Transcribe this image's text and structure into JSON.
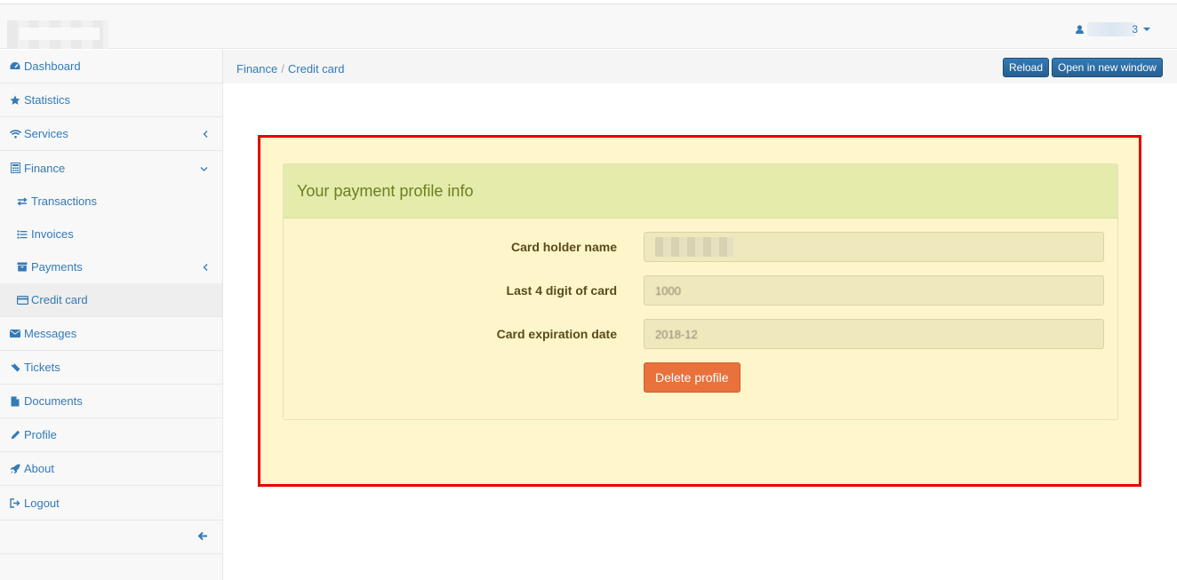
{
  "header": {
    "user_label_tail": "3"
  },
  "sidebar": {
    "items": [
      {
        "label": "Dashboard",
        "icon": "dashboard-icon"
      },
      {
        "label": "Statistics",
        "icon": "star-icon"
      },
      {
        "label": "Services",
        "icon": "wifi-icon"
      },
      {
        "label": "Finance",
        "icon": "calculator-icon"
      },
      {
        "label": "Transactions",
        "icon": "exchange-icon"
      },
      {
        "label": "Invoices",
        "icon": "list-icon"
      },
      {
        "label": "Payments",
        "icon": "archive-icon"
      },
      {
        "label": "Credit card",
        "icon": "credit-card-icon"
      },
      {
        "label": "Messages",
        "icon": "envelope-icon"
      },
      {
        "label": "Tickets",
        "icon": "ticket-icon"
      },
      {
        "label": "Documents",
        "icon": "file-icon"
      },
      {
        "label": "Profile",
        "icon": "pencil-icon"
      },
      {
        "label": "About",
        "icon": "rocket-icon"
      },
      {
        "label": "Logout",
        "icon": "sign-out-icon"
      }
    ]
  },
  "breadcrumb": {
    "parent": "Finance",
    "separator": "/",
    "current": "Credit card"
  },
  "toolbar": {
    "reload_label": "Reload",
    "open_new_window_label": "Open in new window"
  },
  "panel": {
    "title": "Your payment profile info",
    "fields": [
      {
        "label": "Card holder name",
        "value": ""
      },
      {
        "label": "Last 4 digit of card",
        "value": "1000"
      },
      {
        "label": "Card expiration date",
        "value": "2018-12"
      }
    ],
    "delete_label": "Delete profile"
  },
  "colors": {
    "link": "#337ab7",
    "highlight_border": "#e60000",
    "delete_button": "#e8713c"
  }
}
